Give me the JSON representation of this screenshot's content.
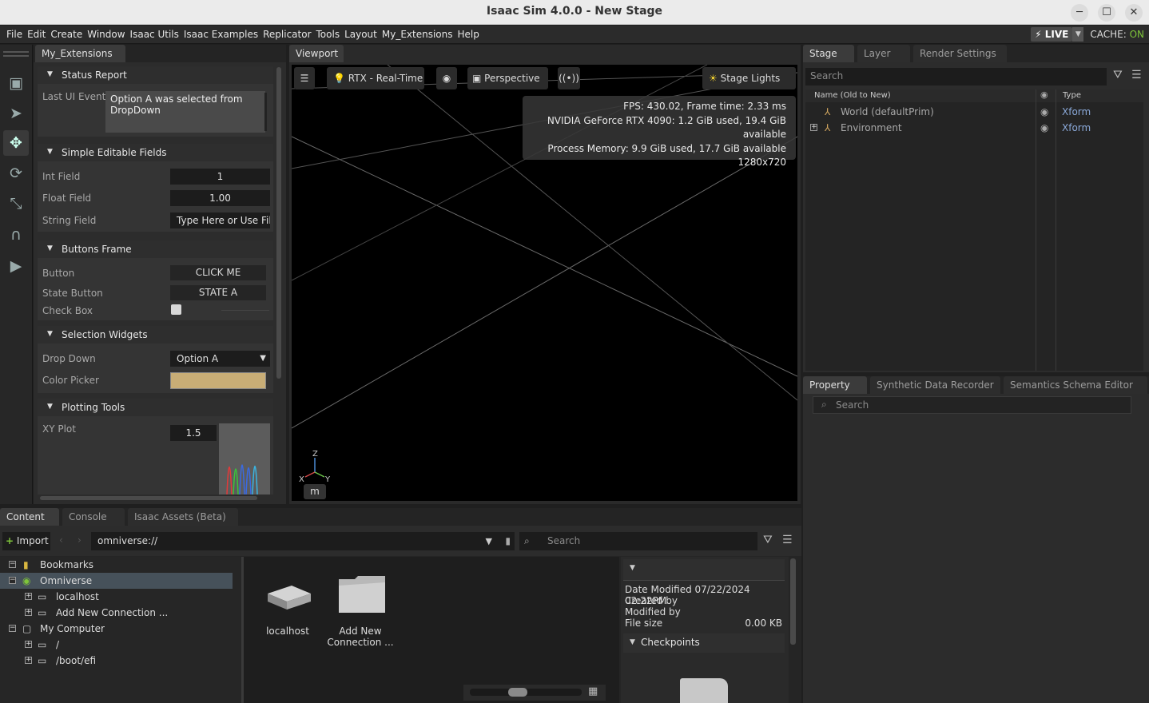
{
  "window": {
    "title": "Isaac Sim 4.0.0 - New Stage",
    "minimize": "─",
    "maximize": "☐",
    "close": "✕"
  },
  "menu": [
    "File",
    "Edit",
    "Create",
    "Window",
    "Isaac Utils",
    "Isaac Examples",
    "Replicator",
    "Tools",
    "Layout",
    "My_Extensions",
    "Help"
  ],
  "status": {
    "live": "⚡ LIVE",
    "cache_label": "CACHE:",
    "cache_value": "ON"
  },
  "extensions_panel": {
    "tab": "My_Extensions",
    "status_report": {
      "title": "Status Report",
      "label": "Last UI Event",
      "value": "Option A was selected from DropDown"
    },
    "editable": {
      "title": "Simple Editable Fields",
      "int_label": "Int Field",
      "int_value": "1",
      "float_label": "Float Field",
      "float_value": "1.00",
      "string_label": "String Field",
      "string_value": "Type Here or Use File"
    },
    "buttons": {
      "title": "Buttons Frame",
      "button_label": "Button",
      "button_text": "CLICK ME",
      "state_label": "State Button",
      "state_text": "STATE A",
      "check_label": "Check Box"
    },
    "selection": {
      "title": "Selection Widgets",
      "drop_label": "Drop Down",
      "drop_value": "Option A",
      "color_label": "Color Picker",
      "color_value": "#c8ad76"
    },
    "plotting": {
      "title": "Plotting Tools",
      "plot_label": "XY Plot",
      "plot_value": "1.5"
    }
  },
  "viewport": {
    "tab": "Viewport",
    "render_mode": "RTX - Real-Time",
    "camera": "Perspective",
    "lights": "Stage Lights",
    "stats": [
      "FPS: 430.02, Frame time: 2.33 ms",
      "NVIDIA GeForce RTX 4090: 1.2 GiB used, 19.4 GiB available",
      "Process Memory: 9.9 GiB used, 17.7 GiB available",
      "1280x720"
    ],
    "axis": {
      "z": "Z",
      "x": "X",
      "y": "Y"
    },
    "unit": "m"
  },
  "stage": {
    "tabs": [
      "Stage",
      "Layer",
      "Render Settings"
    ],
    "search": "Search",
    "col_name": "Name (Old to New)",
    "col_type": "Type",
    "rows": [
      {
        "name": "World (defaultPrim)",
        "type": "Xform"
      },
      {
        "name": "Environment",
        "type": "Xform"
      }
    ]
  },
  "property": {
    "tabs": [
      "Property",
      "Synthetic Data Recorder",
      "Semantics Schema Editor"
    ],
    "search": "Search"
  },
  "content": {
    "tabs": [
      "Content",
      "Console",
      "Isaac Assets (Beta)"
    ],
    "import": "Import",
    "path": "omniverse://",
    "search": "Search",
    "tree": [
      {
        "label": "Bookmarks",
        "toggle": "−"
      },
      {
        "label": "Omniverse",
        "toggle": "−"
      },
      {
        "label": "localhost",
        "toggle": "+"
      },
      {
        "label": "Add New Connection ...",
        "toggle": "+"
      },
      {
        "label": "My Computer",
        "toggle": "−"
      },
      {
        "label": "/",
        "toggle": "+"
      },
      {
        "label": "/boot/efi",
        "toggle": "+"
      }
    ],
    "items": [
      {
        "label": "localhost"
      },
      {
        "label": "Add New Connection ..."
      }
    ],
    "details": {
      "date_modified": "Date Modified 07/22/2024 02:22PM",
      "created_by": "Created by",
      "modified_by": "Modified by",
      "file_size_label": "File size",
      "file_size": "0.00 KB",
      "checkpoints": "Checkpoints"
    }
  }
}
